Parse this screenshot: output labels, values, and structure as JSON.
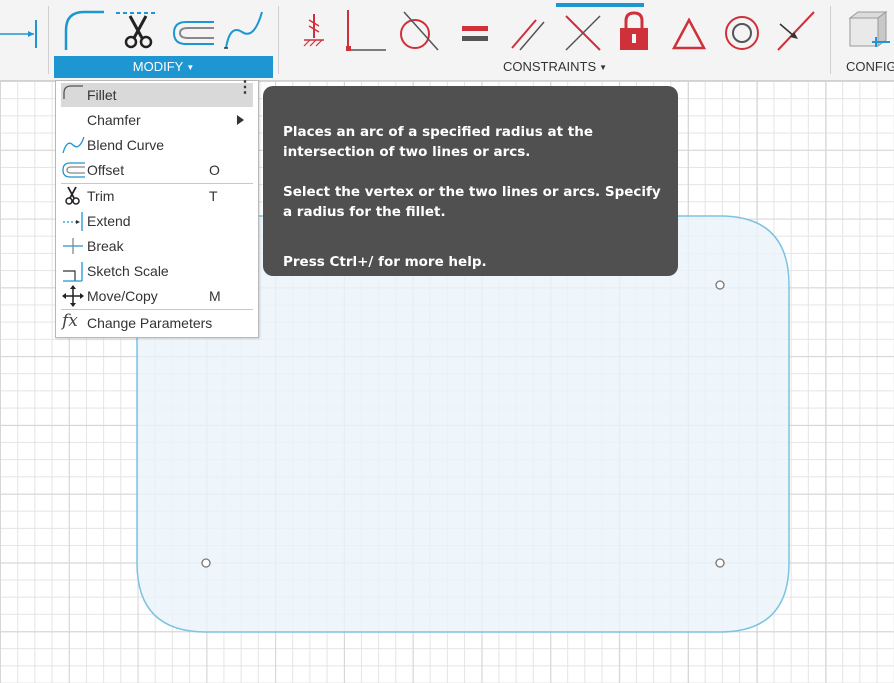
{
  "toolbar": {
    "modify_label": "MODIFY",
    "constraints_label": "CONSTRAINTS",
    "configure_label": "CONFIGURE",
    "modify_tools": [
      "fillet-icon",
      "trim-icon",
      "offset-icon",
      "blend-curve-icon"
    ],
    "constraint_tools": [
      "fix-icon",
      "coincident-icon",
      "tangent-icon",
      "equal-icon",
      "parallel-icon",
      "perpendicular-icon",
      "lock-icon",
      "triangle-icon",
      "concentric-icon",
      "midpoint-icon"
    ],
    "accent_color": "#1e96d2",
    "constraint_color": "#d0303a"
  },
  "modify_menu": {
    "items": [
      {
        "label": "Fillet",
        "shortcut": "",
        "icon": "fillet-icon"
      },
      {
        "label": "Chamfer",
        "shortcut": "",
        "icon": ""
      },
      {
        "label": "Blend Curve",
        "shortcut": "",
        "icon": "blend-curve-icon"
      },
      {
        "label": "Offset",
        "shortcut": "O",
        "icon": "offset-icon"
      },
      {
        "label": "Trim",
        "shortcut": "T",
        "icon": "trim-icon"
      },
      {
        "label": "Extend",
        "shortcut": "",
        "icon": "extend-icon"
      },
      {
        "label": "Break",
        "shortcut": "",
        "icon": "break-icon"
      },
      {
        "label": "Sketch Scale",
        "shortcut": "",
        "icon": "sketch-scale-icon"
      },
      {
        "label": "Move/Copy",
        "shortcut": "M",
        "icon": "move-icon"
      },
      {
        "label": "Change Parameters",
        "shortcut": "",
        "icon": "fx-icon"
      }
    ],
    "more_glyph": "⋮"
  },
  "tooltip": {
    "para1": "Places an arc of a specified radius at the intersection of two lines or arcs.",
    "para2": "Select the vertex or the two lines or arcs. Specify a radius for the fillet.",
    "para3": "Press Ctrl+/ for more help."
  },
  "fx_glyph": "fx",
  "sketch": {
    "fill_color": "#eaf4fb",
    "stroke_color": "#7cc3e2"
  }
}
